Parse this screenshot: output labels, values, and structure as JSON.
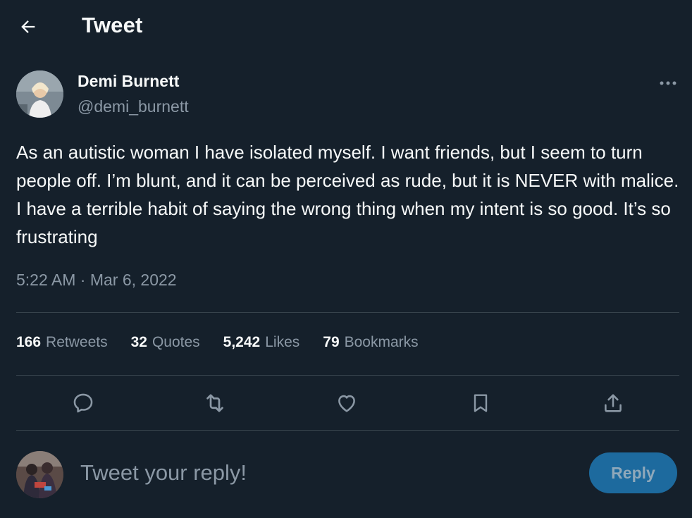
{
  "header": {
    "title": "Tweet",
    "back_icon": "arrow-left-icon"
  },
  "author": {
    "name": "Demi Burnett",
    "handle": "@demi_burnett",
    "more_icon": "ellipsis-icon"
  },
  "tweet": {
    "text": "As an autistic woman I have isolated myself. I want friends, but I seem to turn people off. I’m blunt, and it can be perceived as rude, but it is NEVER with malice. I have a terrible habit of saying the wrong thing when my intent is so good. It’s so frustrating",
    "timestamp": "5:22 AM · Mar 6, 2022"
  },
  "stats": [
    {
      "count": "166",
      "label": "Retweets"
    },
    {
      "count": "32",
      "label": "Quotes"
    },
    {
      "count": "5,242",
      "label": "Likes"
    },
    {
      "count": "79",
      "label": "Bookmarks"
    }
  ],
  "actions": [
    "reply-icon",
    "retweet-icon",
    "like-icon",
    "bookmark-icon",
    "share-icon"
  ],
  "reply": {
    "placeholder": "Tweet your reply!",
    "button_label": "Reply"
  },
  "colors": {
    "background": "#15202b",
    "text_primary": "#f7f9f9",
    "text_secondary": "#8b98a5",
    "divider": "#38444d",
    "accent_disabled": "#1d6a9e"
  }
}
